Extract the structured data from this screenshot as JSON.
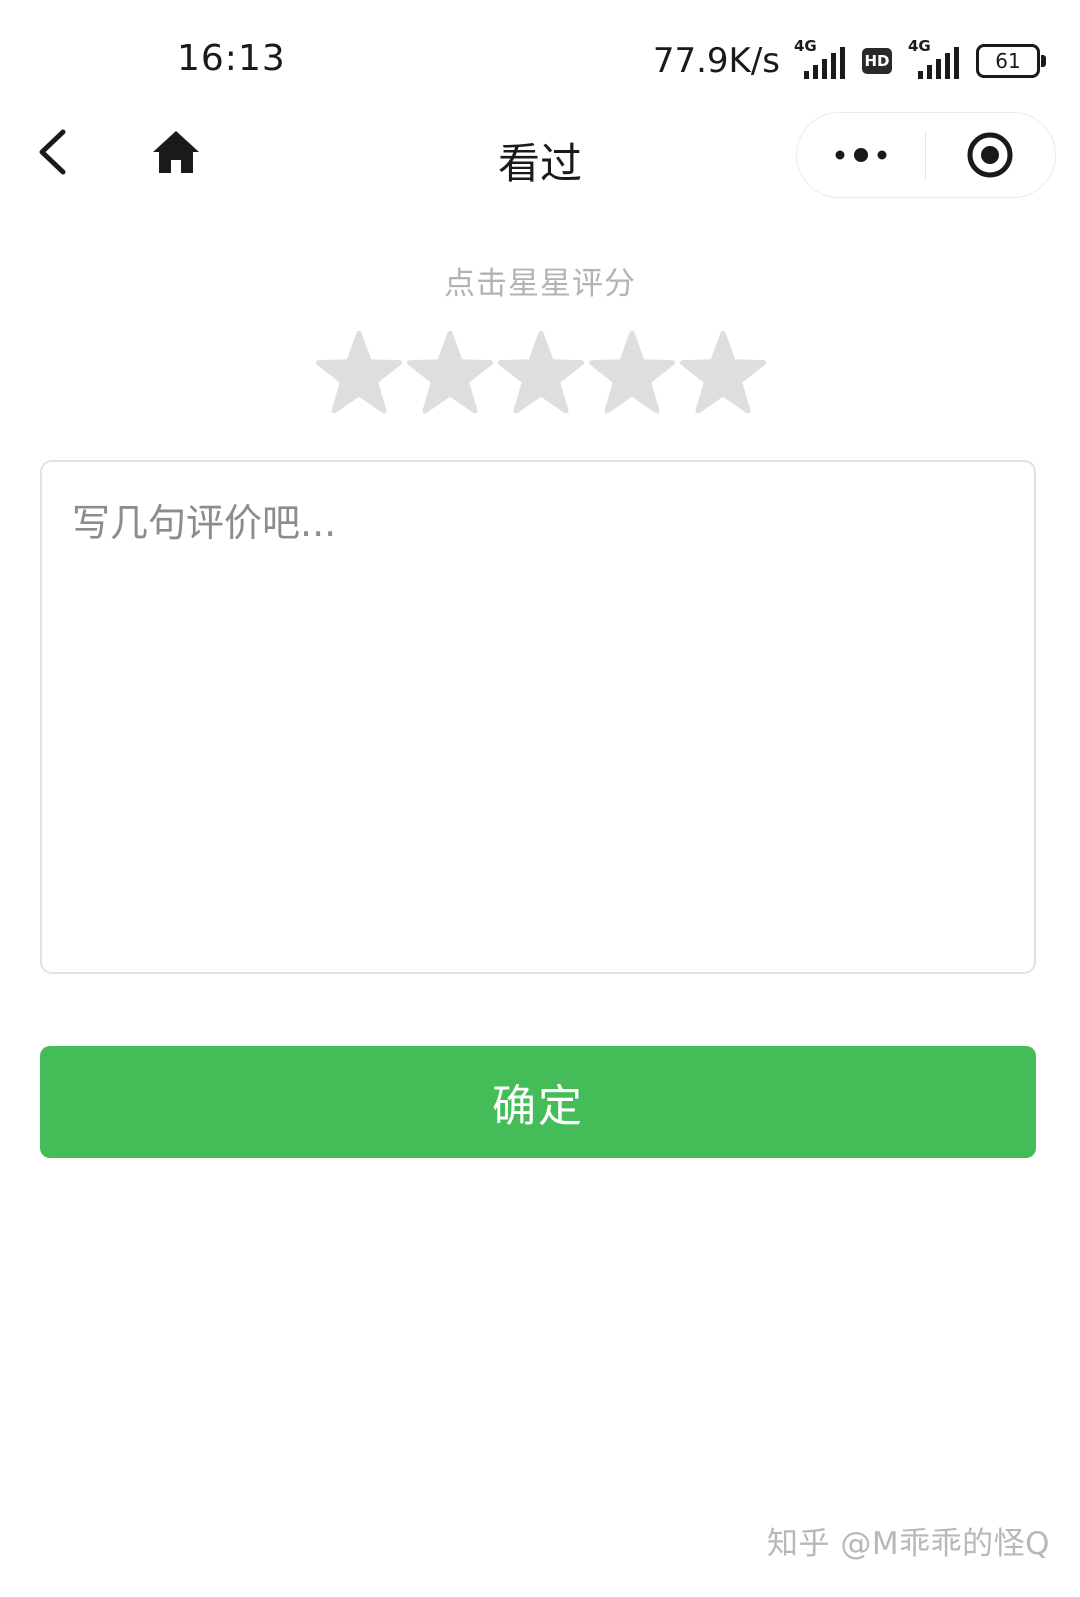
{
  "status_bar": {
    "time": "16:13",
    "net_speed": "77.9K/s",
    "signal_1_tag": "4G",
    "hd_label": "HD",
    "signal_2_tag": "4G",
    "battery_level": "61"
  },
  "nav": {
    "title": "看过",
    "back_icon": "chevron-left-icon",
    "home_icon": "home-icon",
    "more_icon": "more-dots-icon",
    "close_icon": "target-close-icon"
  },
  "rating": {
    "hint": "点击星星评分",
    "max_stars": 5,
    "selected": 0,
    "star_color_empty": "#dedede",
    "star_color_filled": "#f5b82e"
  },
  "review": {
    "placeholder": "写几句评价吧...",
    "value": ""
  },
  "confirm": {
    "label": "确定",
    "color": "#44bd59"
  },
  "watermark": {
    "text": "知乎 @M乖乖的怪Q"
  }
}
